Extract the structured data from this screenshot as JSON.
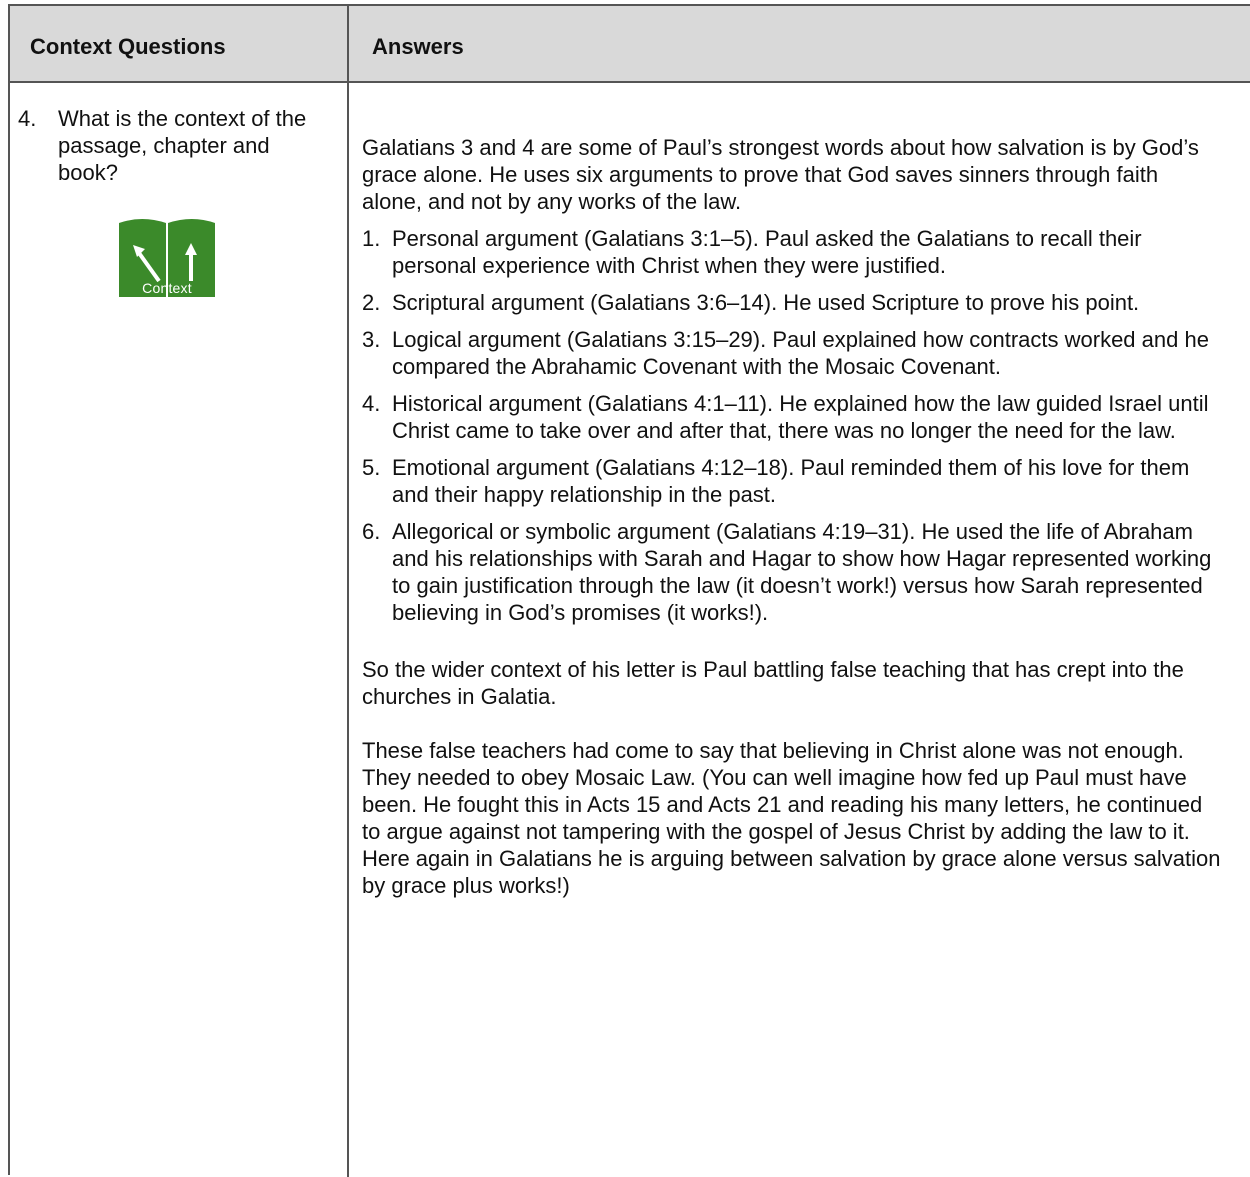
{
  "header": {
    "col1": "Context Questions",
    "col2": "Answers"
  },
  "question": {
    "number": "4.",
    "text": "What is the context of the passage, chapter and book?",
    "icon_label": "Context",
    "icon_name": "context-book-icon",
    "icon_color": "#3b8a2a"
  },
  "answers": {
    "intro": "Galatians 3 and 4 are some of Paul’s strongest words about how salvation is by God’s grace alone. He uses six arguments to prove that God saves sinners through faith alone, and not by any works of the law.",
    "arguments": [
      {
        "num": "1.",
        "text": "Personal argument (Galatians 3:1–5). Paul asked the Galatians to recall their personal experience with Christ when they were justified."
      },
      {
        "num": "2.",
        "text": "Scriptural argument (Galatians 3:6–14). He used Scripture to prove his point."
      },
      {
        "num": "3.",
        "text": "Logical argument (Galatians 3:15–29). Paul explained how contracts worked and he compared the Abrahamic Covenant with the Mosaic Covenant."
      },
      {
        "num": "4.",
        "text": "Historical argument (Galatians 4:1–11). He explained how the law guided Israel until Christ came to take over and after that, there was no longer the need for the law."
      },
      {
        "num": "5.",
        "text": "Emotional argument (Galatians 4:12–18). Paul reminded them of his love for them and their happy relationship in the past."
      },
      {
        "num": "6.",
        "text": "Allegorical or symbolic argument (Galatians 4:19–31). He used the life of Abraham and his relationships with Sarah and Hagar to show how Hagar represented working to gain justification through the law (it doesn’t work!) versus how Sarah represented believing in God’s promises (it works!)."
      }
    ],
    "paragraph1": "So the wider context of his letter is Paul battling false teaching that has crept into the churches in Galatia.",
    "paragraph2": "These false teachers had come to say that believing in Christ alone was not enough. They needed to obey Mosaic Law. (You can well imagine how fed up Paul must have been. He fought this in Acts 15 and Acts 21 and reading his many letters, he continued to argue against not tampering with the gospel of Jesus Christ by adding the law to it. Here again in Galatians he is arguing between salvation by grace alone versus salvation by grace plus works!)"
  }
}
